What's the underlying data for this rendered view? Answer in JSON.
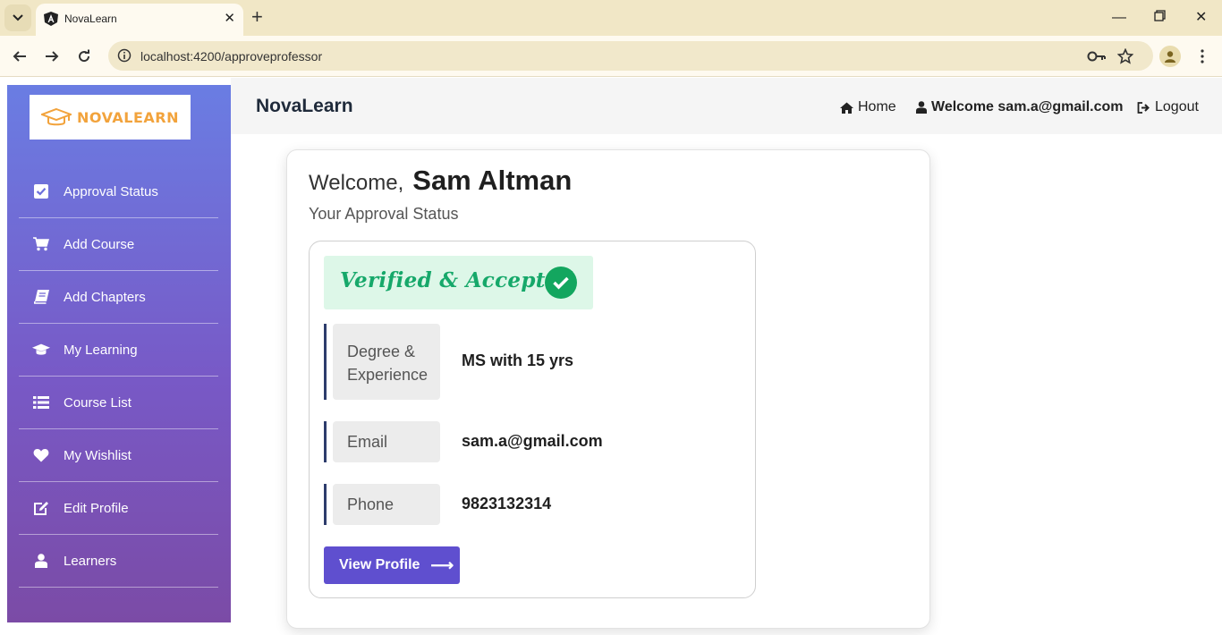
{
  "browser": {
    "tab_title": "NovaLearn",
    "url": "localhost:4200/approveprofessor"
  },
  "sidebar": {
    "logo_text": "NOVALEARN",
    "items": [
      {
        "label": "Approval Status",
        "icon": "check-square-icon"
      },
      {
        "label": "Add Course",
        "icon": "cart-icon"
      },
      {
        "label": "Add Chapters",
        "icon": "book-icon"
      },
      {
        "label": "My Learning",
        "icon": "graduation-cap-icon"
      },
      {
        "label": "Course List",
        "icon": "list-icon"
      },
      {
        "label": "My Wishlist",
        "icon": "heart-icon"
      },
      {
        "label": "Edit Profile",
        "icon": "edit-icon"
      },
      {
        "label": "Learners",
        "icon": "user-icon"
      }
    ]
  },
  "topnav": {
    "brand": "NovaLearn",
    "home": "Home",
    "welcome": "Welcome sam.a@gmail.com",
    "logout": "Logout"
  },
  "main": {
    "greeting": "Welcome,",
    "name": "Sam Altman",
    "subtitle": "Your Approval Status",
    "status_badge": "Verified & Accepted",
    "fields": [
      {
        "label_line1": "Degree &",
        "label_line2": "Experience",
        "value": "MS with 15 yrs"
      },
      {
        "label": "Email",
        "value": "sam.a@gmail.com"
      },
      {
        "label": "Phone",
        "value": "9823132314"
      }
    ],
    "view_profile": "View Profile"
  },
  "colors": {
    "accent": "#5f4fcf",
    "success": "#13a65f",
    "sidebar_top": "#6a7de3",
    "sidebar_bottom": "#7b4ba6"
  }
}
